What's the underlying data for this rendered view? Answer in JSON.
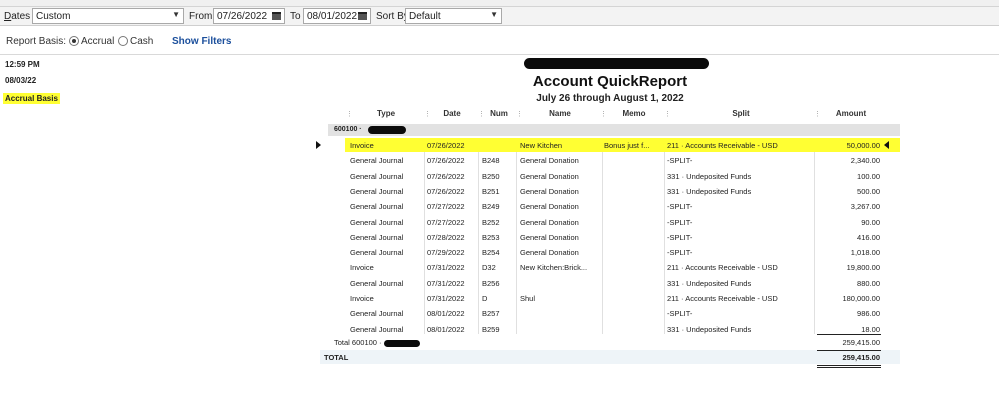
{
  "filters": {
    "dates_label_prefix": "D",
    "dates_label_rest": "ates",
    "dates_value": "Custom",
    "from_label": "From",
    "from_value": "07/26/2022",
    "to_label": "To",
    "to_value": "08/01/2022",
    "sort_label": "Sort By",
    "sort_value": "Default"
  },
  "basis": {
    "label": "Report Basis:",
    "accrual": "Accrual",
    "cash": "Cash",
    "selected": "Accrual",
    "show_filters": "Show Filters"
  },
  "meta": {
    "time": "12:59 PM",
    "date": "08/03/22",
    "basis": "Accrual Basis"
  },
  "report": {
    "title": "Account QuickReport",
    "subtitle": "July 26 through August 1, 2022",
    "columns": [
      "Type",
      "Date",
      "Num",
      "Name",
      "Memo",
      "Split",
      "Amount"
    ],
    "group_label": "600100 ·",
    "rows": [
      {
        "type": "Invoice",
        "date": "07/26/2022",
        "num": "",
        "name": "New Kitchen",
        "memo": "Bonus just f...",
        "split": "211 · Accounts Receivable - USD",
        "amount": "50,000.00",
        "highlight": true
      },
      {
        "type": "General Journal",
        "date": "07/26/2022",
        "num": "B248",
        "name": "General Donation",
        "memo": "",
        "split": "-SPLIT-",
        "amount": "2,340.00"
      },
      {
        "type": "General Journal",
        "date": "07/26/2022",
        "num": "B250",
        "name": "General Donation",
        "memo": "",
        "split": "331 · Undeposited Funds",
        "amount": "100.00"
      },
      {
        "type": "General Journal",
        "date": "07/26/2022",
        "num": "B251",
        "name": "General Donation",
        "memo": "",
        "split": "331 · Undeposited Funds",
        "amount": "500.00"
      },
      {
        "type": "General Journal",
        "date": "07/27/2022",
        "num": "B249",
        "name": "General Donation",
        "memo": "",
        "split": "-SPLIT-",
        "amount": "3,267.00"
      },
      {
        "type": "General Journal",
        "date": "07/27/2022",
        "num": "B252",
        "name": "General Donation",
        "memo": "",
        "split": "-SPLIT-",
        "amount": "90.00"
      },
      {
        "type": "General Journal",
        "date": "07/28/2022",
        "num": "B253",
        "name": "General Donation",
        "memo": "",
        "split": "-SPLIT-",
        "amount": "416.00"
      },
      {
        "type": "General Journal",
        "date": "07/29/2022",
        "num": "B254",
        "name": "General Donation",
        "memo": "",
        "split": "-SPLIT-",
        "amount": "1,018.00"
      },
      {
        "type": "Invoice",
        "date": "07/31/2022",
        "num": "D32",
        "name": "New Kitchen:Brick...",
        "memo": "",
        "split": "211 · Accounts Receivable - USD",
        "amount": "19,800.00"
      },
      {
        "type": "General Journal",
        "date": "07/31/2022",
        "num": "B256",
        "name": "",
        "memo": "",
        "split": "331 · Undeposited Funds",
        "amount": "880.00"
      },
      {
        "type": "Invoice",
        "date": "07/31/2022",
        "num": "D",
        "name": "Shul",
        "memo": "",
        "split": "211 · Accounts Receivable - USD",
        "amount": "180,000.00"
      },
      {
        "type": "General Journal",
        "date": "08/01/2022",
        "num": "B257",
        "name": "",
        "memo": "",
        "split": "-SPLIT-",
        "amount": "986.00"
      },
      {
        "type": "General Journal",
        "date": "08/01/2022",
        "num": "B259",
        "name": "",
        "memo": "",
        "split": "331 · Undeposited Funds",
        "amount": "18.00"
      }
    ],
    "total_label": "Total 600100 ·",
    "total_amount": "259,415.00",
    "grand_label": "TOTAL",
    "grand_amount": "259,415.00"
  },
  "colors": {
    "highlight": "#ffff33",
    "link": "#1b4f9c"
  }
}
